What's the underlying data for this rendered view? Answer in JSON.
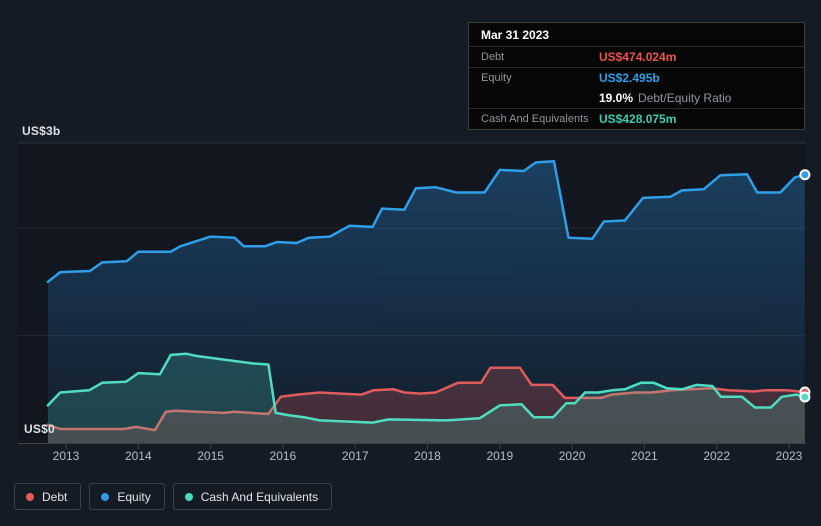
{
  "tooltip": {
    "date": "Mar 31 2023",
    "debt_label": "Debt",
    "debt_value": "US$474.024m",
    "equity_label": "Equity",
    "equity_value": "US$2.495b",
    "ratio_value": "19.0%",
    "ratio_label": "Debt/Equity Ratio",
    "cash_label": "Cash And Equivalents",
    "cash_value": "US$428.075m"
  },
  "y_axis": {
    "top_label": "US$3b",
    "zero_label": "US$0"
  },
  "x_axis": {
    "ticks": [
      "2013",
      "2014",
      "2015",
      "2016",
      "2017",
      "2018",
      "2019",
      "2020",
      "2021",
      "2022",
      "2023"
    ]
  },
  "legend": [
    {
      "id": "debt",
      "label": "Debt",
      "color": "#e25c5c"
    },
    {
      "id": "equity",
      "label": "Equity",
      "color": "#2f9ce8"
    },
    {
      "id": "cash",
      "label": "Cash And Equivalents",
      "color": "#4ad9c0"
    }
  ],
  "colors": {
    "background": "#151b25",
    "plot_background": "#10151e",
    "debt_line": "#e05c5c",
    "equity_line": "#2e9fe8",
    "cash_line": "#50dcc2",
    "gridline": "rgba(255,255,255,0.07)",
    "axis_line": "#3a424e"
  },
  "chart_data": {
    "type": "area",
    "title": "Debt, Equity and Cash And Equivalents history",
    "unit": "US$ billions",
    "x_range": [
      2012.75,
      2023.25
    ],
    "ylim": [
      0,
      3
    ],
    "gridline_values": [
      1,
      2
    ],
    "grid": true,
    "legend_position": "bottom-left",
    "series": [
      {
        "name": "Equity",
        "color": "#2e9fe8",
        "points": [
          [
            2012.75,
            1.5
          ],
          [
            2012.92,
            1.59
          ],
          [
            2013.33,
            1.6
          ],
          [
            2013.5,
            1.68
          ],
          [
            2013.84,
            1.69
          ],
          [
            2014.0,
            1.78
          ],
          [
            2014.45,
            1.78
          ],
          [
            2014.58,
            1.83
          ],
          [
            2015.0,
            1.92
          ],
          [
            2015.33,
            1.91
          ],
          [
            2015.46,
            1.83
          ],
          [
            2015.75,
            1.83
          ],
          [
            2015.92,
            1.87
          ],
          [
            2016.19,
            1.86
          ],
          [
            2016.36,
            1.91
          ],
          [
            2016.65,
            1.92
          ],
          [
            2016.92,
            2.02
          ],
          [
            2017.24,
            2.01
          ],
          [
            2017.37,
            2.18
          ],
          [
            2017.68,
            2.17
          ],
          [
            2017.84,
            2.37
          ],
          [
            2018.11,
            2.38
          ],
          [
            2018.4,
            2.33
          ],
          [
            2018.79,
            2.33
          ],
          [
            2019.0,
            2.54
          ],
          [
            2019.33,
            2.53
          ],
          [
            2019.5,
            2.61
          ],
          [
            2019.75,
            2.62
          ],
          [
            2019.95,
            1.91
          ],
          [
            2020.28,
            1.9
          ],
          [
            2020.44,
            2.06
          ],
          [
            2020.73,
            2.07
          ],
          [
            2020.98,
            2.28
          ],
          [
            2021.36,
            2.29
          ],
          [
            2021.52,
            2.35
          ],
          [
            2021.82,
            2.36
          ],
          [
            2022.05,
            2.49
          ],
          [
            2022.42,
            2.5
          ],
          [
            2022.56,
            2.33
          ],
          [
            2022.88,
            2.33
          ],
          [
            2023.08,
            2.47
          ],
          [
            2023.22,
            2.495
          ]
        ]
      },
      {
        "name": "Debt",
        "color": "#e05c5c",
        "points": [
          [
            2012.75,
            0.17
          ],
          [
            2012.92,
            0.13
          ],
          [
            2013.8,
            0.13
          ],
          [
            2013.97,
            0.15
          ],
          [
            2014.23,
            0.12
          ],
          [
            2014.38,
            0.29
          ],
          [
            2014.52,
            0.3
          ],
          [
            2015.18,
            0.28
          ],
          [
            2015.33,
            0.29
          ],
          [
            2015.8,
            0.27
          ],
          [
            2015.97,
            0.43
          ],
          [
            2016.2,
            0.45
          ],
          [
            2016.51,
            0.47
          ],
          [
            2016.8,
            0.46
          ],
          [
            2017.09,
            0.45
          ],
          [
            2017.25,
            0.49
          ],
          [
            2017.53,
            0.5
          ],
          [
            2017.68,
            0.47
          ],
          [
            2017.9,
            0.46
          ],
          [
            2018.11,
            0.47
          ],
          [
            2018.42,
            0.56
          ],
          [
            2018.74,
            0.56
          ],
          [
            2018.87,
            0.7
          ],
          [
            2019.28,
            0.7
          ],
          [
            2019.44,
            0.54
          ],
          [
            2019.73,
            0.54
          ],
          [
            2019.9,
            0.42
          ],
          [
            2020.4,
            0.42
          ],
          [
            2020.55,
            0.45
          ],
          [
            2020.87,
            0.47
          ],
          [
            2021.1,
            0.47
          ],
          [
            2021.38,
            0.49
          ],
          [
            2021.63,
            0.5
          ],
          [
            2021.93,
            0.51
          ],
          [
            2022.16,
            0.49
          ],
          [
            2022.52,
            0.48
          ],
          [
            2022.67,
            0.49
          ],
          [
            2022.97,
            0.49
          ],
          [
            2023.22,
            0.474
          ]
        ]
      },
      {
        "name": "Cash And Equivalents",
        "color": "#50dcc2",
        "points": [
          [
            2012.75,
            0.35
          ],
          [
            2012.92,
            0.47
          ],
          [
            2013.32,
            0.49
          ],
          [
            2013.5,
            0.56
          ],
          [
            2013.83,
            0.57
          ],
          [
            2014.0,
            0.65
          ],
          [
            2014.3,
            0.64
          ],
          [
            2014.45,
            0.82
          ],
          [
            2014.67,
            0.83
          ],
          [
            2014.8,
            0.81
          ],
          [
            2015.25,
            0.77
          ],
          [
            2015.58,
            0.74
          ],
          [
            2015.8,
            0.73
          ],
          [
            2015.9,
            0.28
          ],
          [
            2016.07,
            0.26
          ],
          [
            2016.29,
            0.24
          ],
          [
            2016.51,
            0.21
          ],
          [
            2017.24,
            0.19
          ],
          [
            2017.46,
            0.22
          ],
          [
            2018.26,
            0.21
          ],
          [
            2018.72,
            0.23
          ],
          [
            2019.0,
            0.35
          ],
          [
            2019.3,
            0.36
          ],
          [
            2019.47,
            0.24
          ],
          [
            2019.74,
            0.24
          ],
          [
            2019.92,
            0.37
          ],
          [
            2020.04,
            0.37
          ],
          [
            2020.18,
            0.47
          ],
          [
            2020.36,
            0.47
          ],
          [
            2020.55,
            0.49
          ],
          [
            2020.73,
            0.5
          ],
          [
            2020.95,
            0.56
          ],
          [
            2021.13,
            0.56
          ],
          [
            2021.31,
            0.51
          ],
          [
            2021.52,
            0.5
          ],
          [
            2021.72,
            0.54
          ],
          [
            2021.94,
            0.53
          ],
          [
            2022.06,
            0.43
          ],
          [
            2022.35,
            0.43
          ],
          [
            2022.53,
            0.33
          ],
          [
            2022.75,
            0.33
          ],
          [
            2022.9,
            0.43
          ],
          [
            2023.1,
            0.45
          ],
          [
            2023.22,
            0.428
          ]
        ]
      }
    ],
    "last_point_markers": true
  }
}
